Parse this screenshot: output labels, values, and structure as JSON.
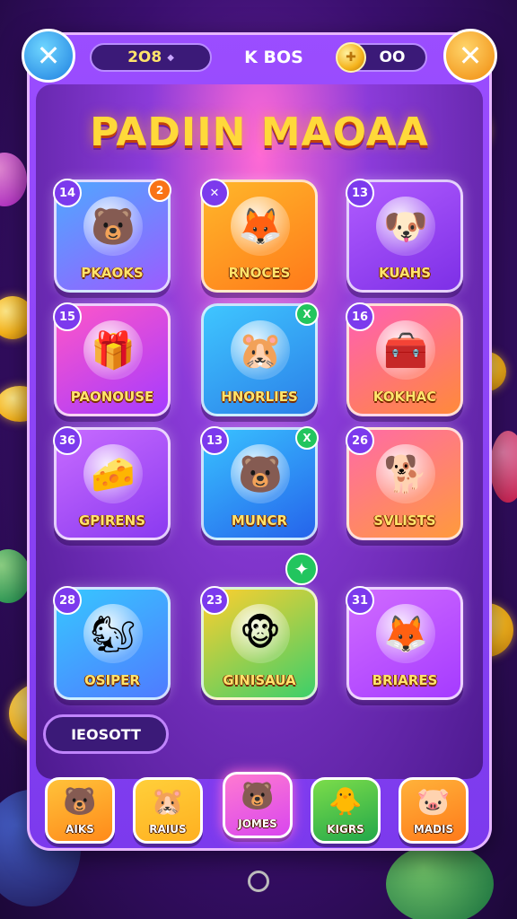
{
  "topbar": {
    "score": "2O8",
    "label": "K BOS",
    "coins": "OO"
  },
  "title": "PADIIN MAOAA",
  "tiles": [
    {
      "badge": "14",
      "corner": "2",
      "label": "PKAOKS",
      "icon": "bear-icon",
      "glyph": "🐻",
      "bg": "#4fa8ff",
      "bg2": "#9b5cff",
      "corner_color": "orange"
    },
    {
      "badge": "✕",
      "corner": "",
      "label": "RNOCES",
      "icon": "fox-icon",
      "glyph": "🦊",
      "bg": "#ffb72a",
      "bg2": "#ff7a1a",
      "corner_color": ""
    },
    {
      "badge": "13",
      "corner": "",
      "label": "KUAHS",
      "icon": "blocks-icon",
      "glyph": "🐶",
      "bg": "#b15cff",
      "bg2": "#7d2fe6",
      "corner_color": ""
    },
    {
      "badge": "15",
      "corner": "",
      "label": "PAONOUSE",
      "icon": "gift-icon",
      "glyph": "🎁",
      "bg": "#ff56c8",
      "bg2": "#a53bff",
      "corner_color": ""
    },
    {
      "badge": "",
      "corner": "X",
      "label": "HNORLIES",
      "icon": "hamster-icon",
      "glyph": "🐹",
      "bg": "#3fc6ff",
      "bg2": "#2b7fe8",
      "corner_color": "green"
    },
    {
      "badge": "16",
      "corner": "",
      "label": "KOKHAC",
      "icon": "treasure-chest-icon",
      "glyph": "🧰",
      "bg": "#ff5fb5",
      "bg2": "#ff8a3a",
      "corner_color": "orange"
    },
    {
      "badge": "36",
      "corner": "",
      "label": "GPIRENS",
      "icon": "cheese-icon",
      "glyph": "🧀",
      "bg": "#c86bff",
      "bg2": "#8a3af0",
      "corner_color": ""
    },
    {
      "badge": "13",
      "corner": "X",
      "label": "MUNCR",
      "icon": "mole-icon",
      "glyph": "🐻",
      "bg": "#39c2ff",
      "bg2": "#2563eb",
      "corner_color": "green"
    },
    {
      "badge": "26",
      "corner": "",
      "label": "SVLISTS",
      "icon": "chihuahua-icon",
      "glyph": "🐕",
      "bg": "#ff6aa8",
      "bg2": "#ff9a3c",
      "corner_color": ""
    },
    {
      "badge": "28",
      "corner": "",
      "label": "OSIPER",
      "icon": "squirrel-icon",
      "glyph": "🐿",
      "bg": "#37c7ff",
      "bg2": "#4f7bff",
      "corner_color": ""
    },
    {
      "badge": "23",
      "corner": "",
      "label": "GINISAUA",
      "icon": "monkey-icon",
      "glyph": "🐵",
      "bg": "#ffcf2e",
      "bg2": "#3ccf6a",
      "corner_color": ""
    },
    {
      "badge": "31",
      "corner": "",
      "label": "BRIARES",
      "icon": "fox-cub-icon",
      "glyph": "🦊",
      "bg": "#d16bff",
      "bg2": "#a53bff",
      "corner_color": ""
    }
  ],
  "ribbon": "IEOSOTT",
  "nav": [
    {
      "label": "AIKS",
      "icon": "bear-face-icon",
      "glyph": "🐻",
      "bg": "#ffc23a",
      "bg2": "#ff8a1a",
      "active": false
    },
    {
      "label": "RAIUS",
      "icon": "hamster-face-icon",
      "glyph": "🐹",
      "bg": "#ffcf3a",
      "bg2": "#ffb020",
      "active": false
    },
    {
      "label": "JOMES",
      "icon": "mole-face-icon",
      "glyph": "🐻",
      "bg": "#ff7ad0",
      "bg2": "#d946ef",
      "active": true
    },
    {
      "label": "KIGRS",
      "icon": "chick-face-icon",
      "glyph": "🐥",
      "bg": "#7cdc4a",
      "bg2": "#22a84a",
      "active": false
    },
    {
      "label": "MADIS",
      "icon": "pig-face-icon",
      "glyph": "🐷",
      "bg": "#ffb23a",
      "bg2": "#ff7a1a",
      "active": false
    }
  ]
}
